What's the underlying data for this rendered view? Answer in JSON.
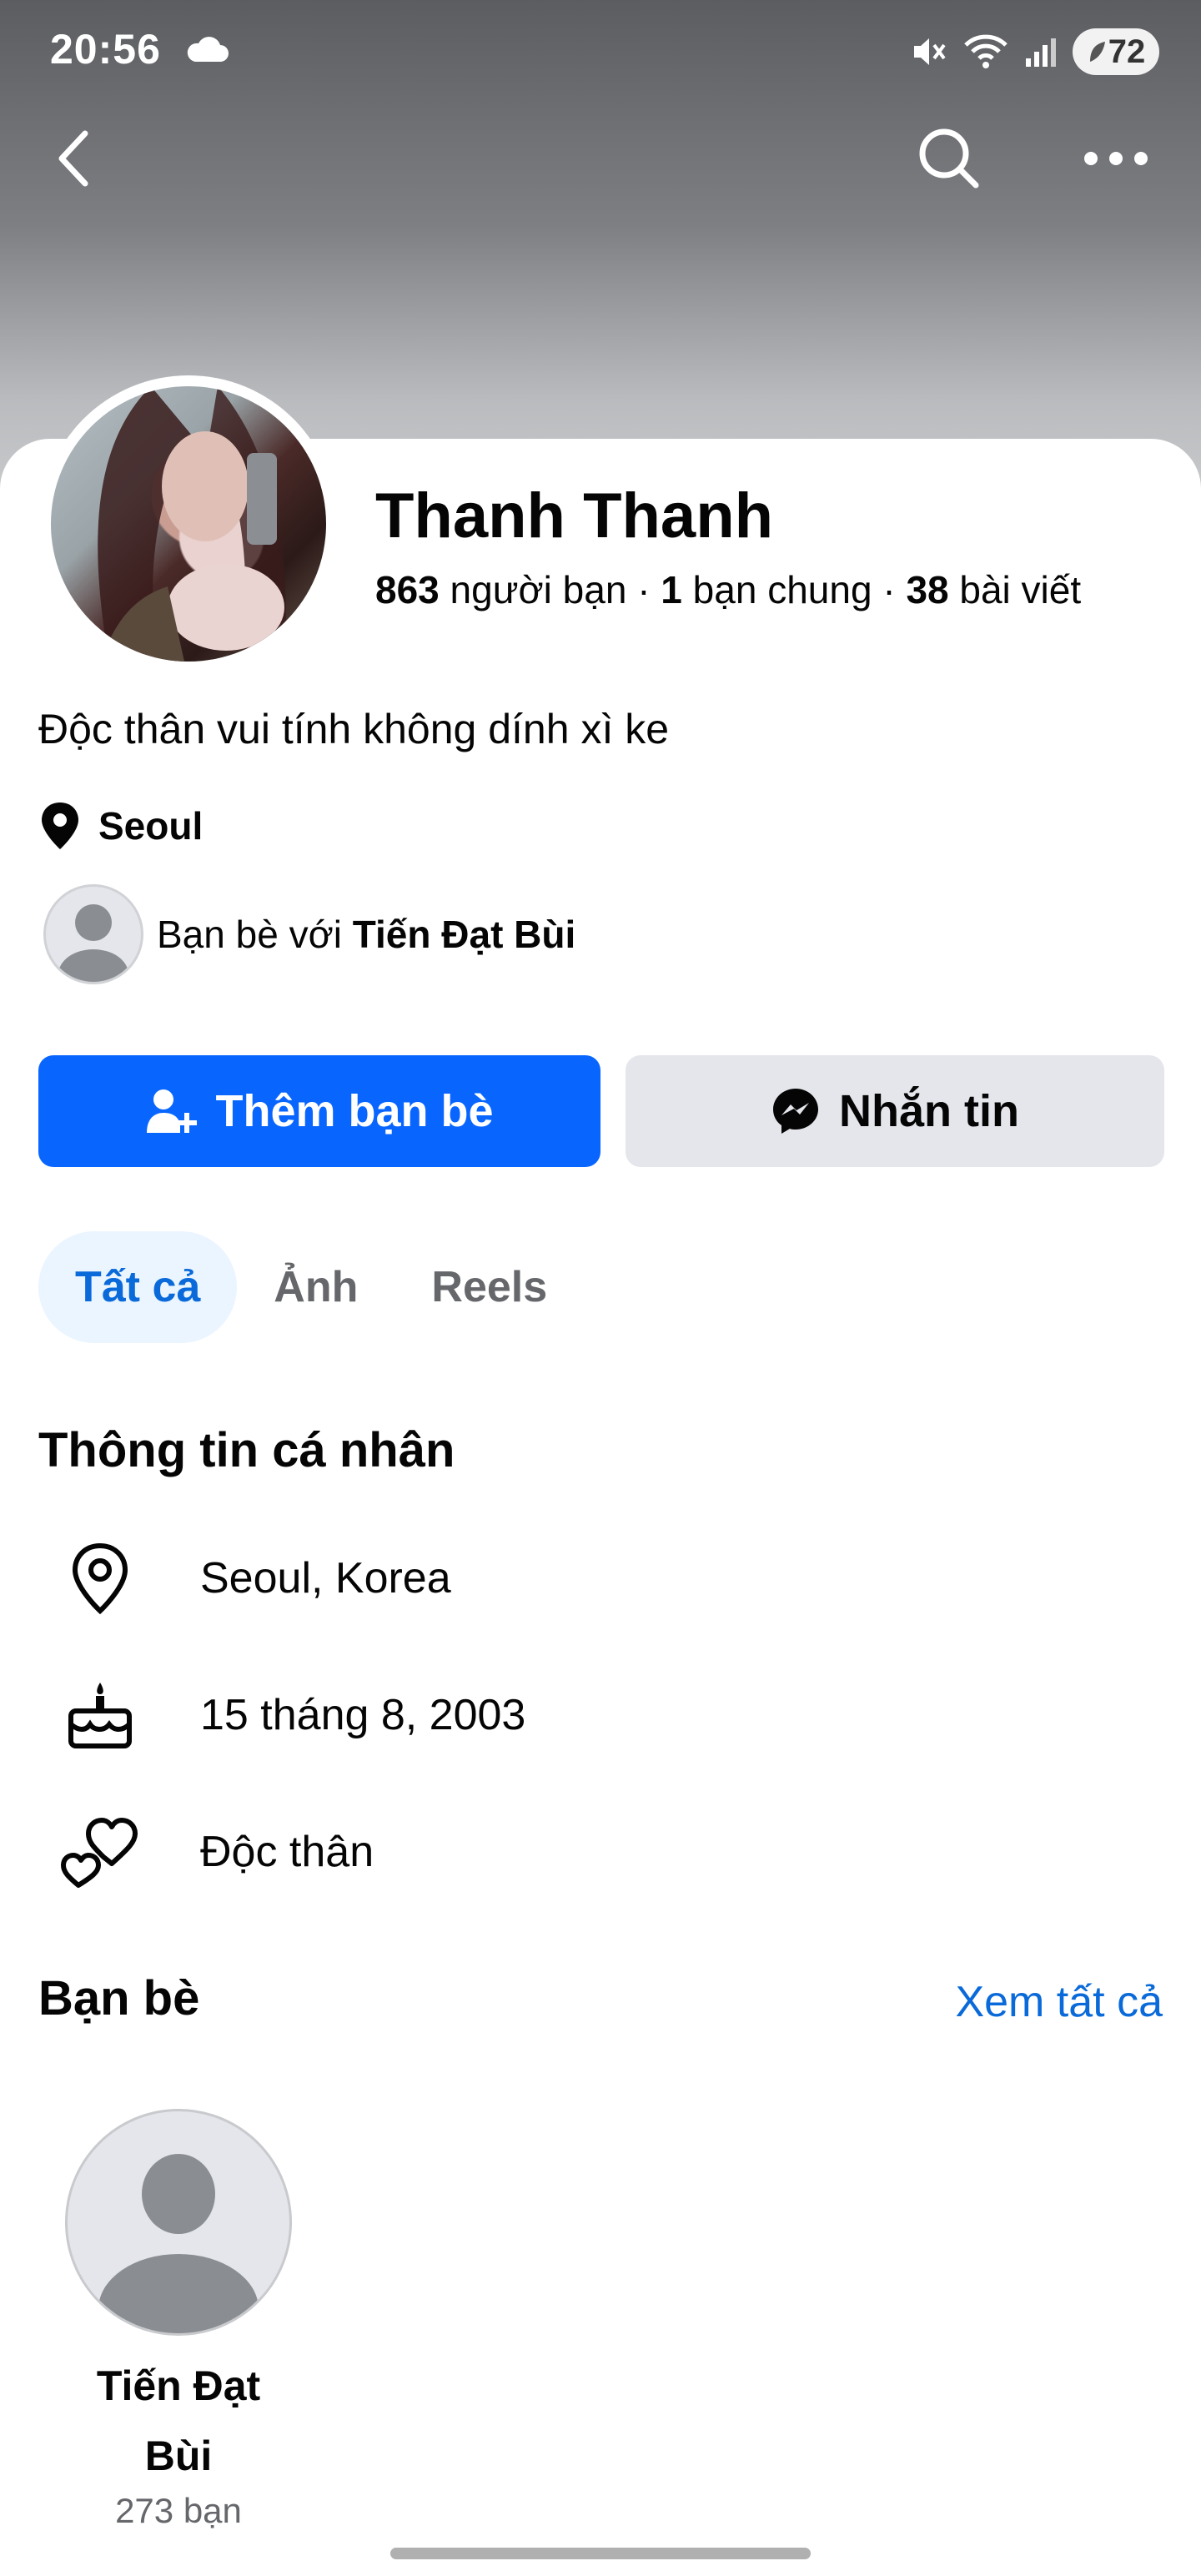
{
  "status_bar": {
    "time": "20:56",
    "battery": "72"
  },
  "profile": {
    "name": "Thanh Thanh",
    "friends_count": "863",
    "friends_label": "người bạn",
    "mutual_count": "1",
    "mutual_label": "bạn chung",
    "posts_count": "38",
    "posts_label": "bài viết",
    "bio": "Độc thân vui tính không dính xì ke",
    "location": "Seoul",
    "mutual_prefix": "Bạn bè với",
    "mutual_name": "Tiến Đạt Bùi"
  },
  "actions": {
    "add_friend": "Thêm bạn bè",
    "message": "Nhắn tin"
  },
  "tabs": [
    {
      "label": "Tất cả",
      "active": true
    },
    {
      "label": "Ảnh",
      "active": false
    },
    {
      "label": "Reels",
      "active": false
    }
  ],
  "about": {
    "title": "Thông tin cá nhân",
    "items": [
      {
        "icon": "location-pin-icon",
        "text": "Seoul, Korea"
      },
      {
        "icon": "birthday-cake-icon",
        "text": "15 tháng 8, 2003"
      },
      {
        "icon": "relationship-hearts-icon",
        "text": "Độc thân"
      }
    ]
  },
  "friends": {
    "title": "Bạn bè",
    "see_all": "Xem tất cả",
    "list": [
      {
        "name": "Tiến Đạt Bùi",
        "count": "273 bạn"
      }
    ]
  },
  "colors": {
    "primary": "#0866ff",
    "link": "#0a6ad9",
    "secondary_button": "#e4e6eb",
    "active_tab_bg": "#ebf5ff"
  }
}
